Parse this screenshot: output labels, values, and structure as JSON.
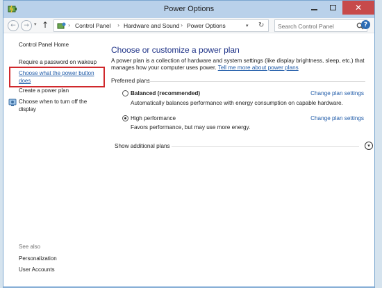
{
  "window": {
    "title": "Power Options",
    "close_glyph": "✕"
  },
  "address": {
    "crumbs": [
      "Control Panel",
      "Hardware and Sound",
      "Power Options"
    ],
    "separator": "›",
    "search_placeholder": "Search Control Panel"
  },
  "sidebar": {
    "home": "Control Panel Home",
    "require_password": "Require a password on wakeup",
    "power_button_line1": "Choose what the power button",
    "power_button_line2": "does",
    "create_plan": "Create a power plan",
    "turn_off_line1": "Choose when to turn off the",
    "turn_off_line2": "display",
    "see_also": "See also",
    "personalization": "Personalization",
    "user_accounts": "User Accounts"
  },
  "main": {
    "heading": "Choose or customize a power plan",
    "desc_text": "A power plan is a collection of hardware and system settings (like display brightness, sleep, etc.) that manages how your computer uses power. ",
    "desc_link": "Tell me more about power plans",
    "group_label": "Preferred plans",
    "plans": [
      {
        "name": "Balanced (recommended)",
        "description": "Automatically balances performance with energy consumption on capable hardware.",
        "link": "Change plan settings",
        "selected": false
      },
      {
        "name": "High performance",
        "description": "Favors performance, but may use more energy.",
        "link": "Change plan settings",
        "selected": true
      }
    ],
    "show_more": "Show additional plans"
  },
  "colors": {
    "titlebar": "#b9d1ea",
    "close": "#c74a4a",
    "link": "#1e5aa8",
    "heading": "#1e3287",
    "highlight": "#d0282c"
  }
}
